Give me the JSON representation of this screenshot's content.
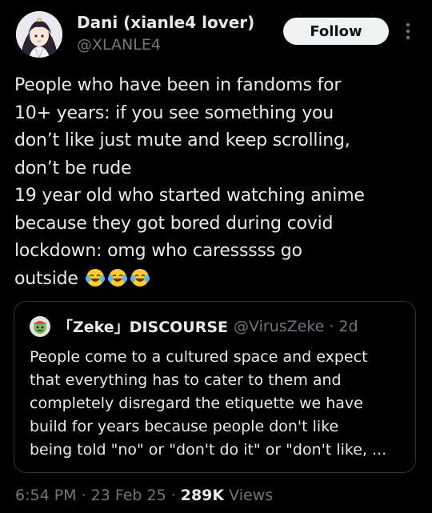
{
  "author": {
    "display_name": "Dani (xianle4 lover)",
    "handle": "@XLANLE4"
  },
  "follow_button_label": "Follow",
  "tweet_text_lines": [
    "People who have been in fandoms for",
    "10+ years: if you see something you",
    "don’t like just mute and keep scrolling,",
    "don’t be rude",
    "19 year old who started watching anime",
    "because they got bored during covid",
    "lockdown: omg who caresssss go",
    "outside"
  ],
  "emojis": [
    "face-with-tears-of-joy-icon",
    "face-with-tears-of-joy-icon",
    "face-with-tears-of-joy-icon"
  ],
  "quote": {
    "display_name": "「Zeke」DISCOURSE",
    "handle": "@VirusZeke",
    "separator": "·",
    "time": "2d",
    "text_lines": [
      "People come to a cultured space and expect",
      "that everything has to cater to them and",
      "completely disregard the etiquette we have",
      "build for years because people don't like",
      "being told \"no\" or \"don't do it\" or \"don't like, ..."
    ]
  },
  "meta": {
    "time": "6:54 PM",
    "separator": "·",
    "date": "23 Feb 25",
    "views_count": "289K",
    "views_label": "Views"
  },
  "colors": {
    "background": "#000000",
    "primary_text": "#e7e9ea",
    "secondary_text": "#71767b",
    "border": "#2f3336",
    "follow_bg": "#eff3f4",
    "follow_text": "#0f1419"
  }
}
